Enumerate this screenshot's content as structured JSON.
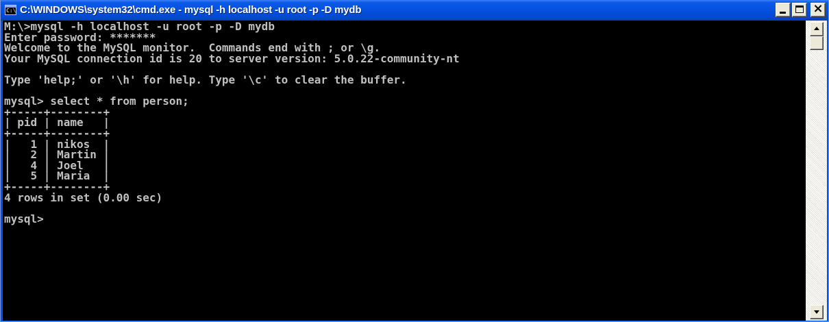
{
  "window": {
    "title": "C:\\WINDOWS\\system32\\cmd.exe - mysql -h localhost -u root -p -D mydb",
    "icon_name": "cmd-icon",
    "icon_text": "C:\\",
    "minimize_icon": "minimize-icon",
    "maximize_icon": "maximize-icon",
    "close_icon": "close-icon",
    "close_glyph": "×"
  },
  "colors": {
    "titlebar": "#0550e0",
    "console_bg": "#000000",
    "console_text": "#c0c0c0"
  },
  "console": {
    "lines": [
      "M:\\>mysql -h localhost -u root -p -D mydb",
      "Enter password: *******",
      "Welcome to the MySQL monitor.  Commands end with ; or \\g.",
      "Your MySQL connection id is 20 to server version: 5.0.22-community-nt",
      "",
      "Type 'help;' or '\\h' for help. Type '\\c' to clear the buffer.",
      "",
      "mysql> select * from person;",
      "+-----+--------+",
      "| pid | name   |",
      "+-----+--------+",
      "|   1 | nikos  |",
      "|   2 | Martin |",
      "|   4 | Joel   |",
      "|   5 | Maria  |",
      "+-----+--------+",
      "4 rows in set (0.00 sec)",
      "",
      "mysql>"
    ],
    "query_result": {
      "columns": [
        "pid",
        "name"
      ],
      "rows": [
        [
          "1",
          "nikos"
        ],
        [
          "2",
          "Martin"
        ],
        [
          "4",
          "Joel"
        ],
        [
          "5",
          "Maria"
        ]
      ],
      "summary": "4 rows in set (0.00 sec)"
    }
  },
  "scrollbar": {
    "up_icon": "scroll-up-arrow-icon",
    "down_icon": "scroll-down-arrow-icon"
  }
}
